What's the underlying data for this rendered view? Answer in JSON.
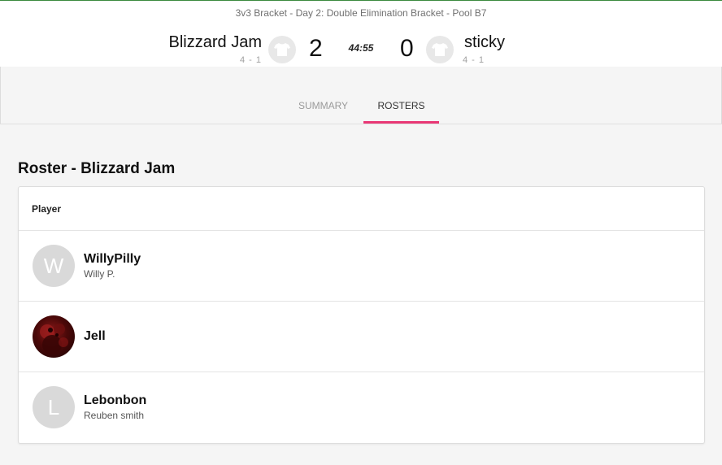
{
  "game": {
    "title": "3v3 Bracket - Day 2: Double Elimination Bracket - Pool B7",
    "clock": "44:55",
    "home": {
      "name": "Blizzard Jam",
      "record": "4 - 1",
      "score": "2"
    },
    "away": {
      "name": "sticky",
      "record": "4 - 1",
      "score": "0"
    }
  },
  "tabs": [
    {
      "label": "SUMMARY",
      "active": false
    },
    {
      "label": "ROSTERS",
      "active": true
    }
  ],
  "accent_color": "#e93775",
  "roster": {
    "title": "Roster - Blizzard Jam",
    "column_header": "Player",
    "players": [
      {
        "name": "WillyPilly",
        "full_name": "Willy P.",
        "initial": "W",
        "avatar": "initial-avatar"
      },
      {
        "name": "Jell",
        "full_name": "",
        "initial": "",
        "avatar": "photo-avatar"
      },
      {
        "name": "Lebonbon",
        "full_name": "Reuben smith",
        "initial": "L",
        "avatar": "initial-avatar"
      }
    ]
  },
  "icons": {
    "home_jersey": "jersey-icon",
    "away_jersey": "jersey-icon"
  }
}
